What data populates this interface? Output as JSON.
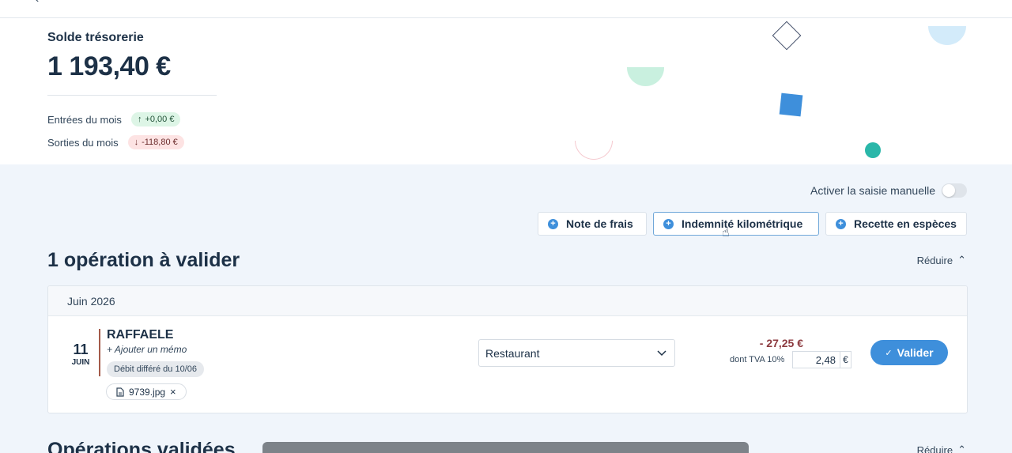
{
  "hero": {
    "label": "Solde trésorerie",
    "amount": "1 193,40 €",
    "in_label": "Entrées du mois",
    "in_value": "+0,00 €",
    "out_label": "Sorties du mois",
    "out_value": "-118,80 €"
  },
  "manual": {
    "label": "Activer la saisie manuelle",
    "enabled": false
  },
  "actions": [
    {
      "label": "Note de frais"
    },
    {
      "label": "Indemnité kilométrique"
    },
    {
      "label": "Recette en espèces"
    }
  ],
  "pending": {
    "title": "1 opération à valider",
    "reduce_label": "Réduire",
    "month": "Juin 2026",
    "operation": {
      "day": "11",
      "month": "JUIN",
      "merchant": "RAFFAELE",
      "memo": "+ Ajouter un mémo",
      "deferred": "Débit différé du 10/06",
      "attachment": "9739.jpg",
      "category": "Restaurant",
      "amount": "- 27,25 €",
      "vat_label": "dont TVA 10%",
      "vat_value": "2,48",
      "currency": "€",
      "validate_label": "Valider"
    }
  },
  "validated": {
    "title": "Opérations validées",
    "reduce_label": "Réduire"
  },
  "colors": {
    "accent": "#3e8fdb",
    "negative": "#8c3a3f",
    "positive_bg": "#ddf5e6",
    "negative_bg": "#fde3e3"
  },
  "icons": {
    "back": "chevron-left-icon",
    "plus": "plus-circle-icon",
    "file": "file-icon",
    "chevron": "chevron-down-icon"
  }
}
